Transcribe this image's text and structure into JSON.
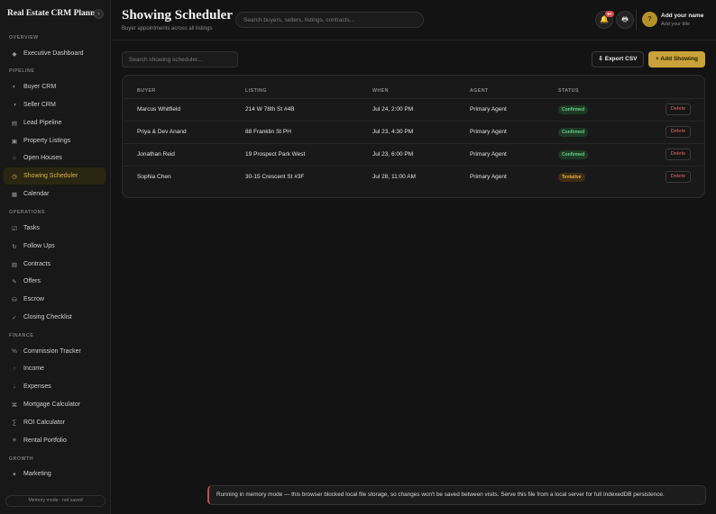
{
  "app": {
    "title": "Real Estate CRM Planner",
    "collapse_icon": "‹"
  },
  "sidebar": {
    "sections": {
      "overview": "OVERVIEW",
      "pipeline": "PIPELINE",
      "operations": "OPERATIONS",
      "finance": "FINANCE",
      "growth": "GROWTH"
    },
    "items": [
      {
        "label": "Executive Dashboard",
        "icon": "◆"
      },
      {
        "label": "Buyer CRM",
        "icon": "◐"
      },
      {
        "label": "Seller CRM",
        "icon": "◑"
      },
      {
        "label": "Lead Pipeline",
        "icon": "▤"
      },
      {
        "label": "Property Listings",
        "icon": "▣"
      },
      {
        "label": "Open Houses",
        "icon": "⌂"
      },
      {
        "label": "Showing Scheduler",
        "icon": "◷"
      },
      {
        "label": "Calendar",
        "icon": "▦"
      },
      {
        "label": "Tasks",
        "icon": "☑"
      },
      {
        "label": "Follow Ups",
        "icon": "↻"
      },
      {
        "label": "Contracts",
        "icon": "▧"
      },
      {
        "label": "Offers",
        "icon": "✎"
      },
      {
        "label": "Escrow",
        "icon": "⛁"
      },
      {
        "label": "Closing Checklist",
        "icon": "✓"
      },
      {
        "label": "Commission Tracker",
        "icon": "%"
      },
      {
        "label": "Income",
        "icon": "↑"
      },
      {
        "label": "Expenses",
        "icon": "↓"
      },
      {
        "label": "Mortgage Calculator",
        "icon": "⌘"
      },
      {
        "label": "ROI Calculator",
        "icon": "∑"
      },
      {
        "label": "Rental Portfolio",
        "icon": "≡"
      },
      {
        "label": "Marketing",
        "icon": "✦"
      }
    ],
    "active_index": 6,
    "footer": "Memory mode · not saved"
  },
  "header": {
    "title": "Showing Scheduler",
    "subtitle": "Buyer appointments across all listings",
    "search_placeholder": "Search buyers, sellers, listings, contracts...",
    "notification_icon": "🔔",
    "notification_badge": "9+",
    "print_icon": "🖶",
    "profile": {
      "avatar": "?",
      "name": "Add your name",
      "subtitle": "Add your title"
    }
  },
  "toolbar": {
    "search_placeholder": "Search showing scheduler...",
    "export_label": "⇩ Export CSV",
    "add_label": "+ Add Showing"
  },
  "table": {
    "columns": [
      "BUYER",
      "LISTING",
      "WHEN",
      "AGENT",
      "STATUS"
    ],
    "delete_label": "Delete",
    "rows": [
      {
        "buyer": "Marcus Whitfield",
        "listing": "214 W 78th St #4B",
        "when": "Jul 24, 2:00 PM",
        "agent": "Primary Agent",
        "status": "Confirmed"
      },
      {
        "buyer": "Priya & Dev Anand",
        "listing": "88 Franklin St PH",
        "when": "Jul 23, 4:30 PM",
        "agent": "Primary Agent",
        "status": "Confirmed"
      },
      {
        "buyer": "Jonathan Reid",
        "listing": "19 Prospect Park West",
        "when": "Jul 23, 6:00 PM",
        "agent": "Primary Agent",
        "status": "Confirmed"
      },
      {
        "buyer": "Sophia Chen",
        "listing": "30-15 Crescent St #3F",
        "when": "Jul 28, 11:00 AM",
        "agent": "Primary Agent",
        "status": "Tentative"
      }
    ]
  },
  "toast": {
    "message": "Running in memory mode — this browser blocked local file storage, so changes won't be saved between visits. Serve this file from a local server for full IndexedDB persistence."
  },
  "colors": {
    "accent": "#c9a33a",
    "confirmed": "#6ccf8a",
    "tentative": "#e3a94a",
    "danger": "#e06262"
  }
}
